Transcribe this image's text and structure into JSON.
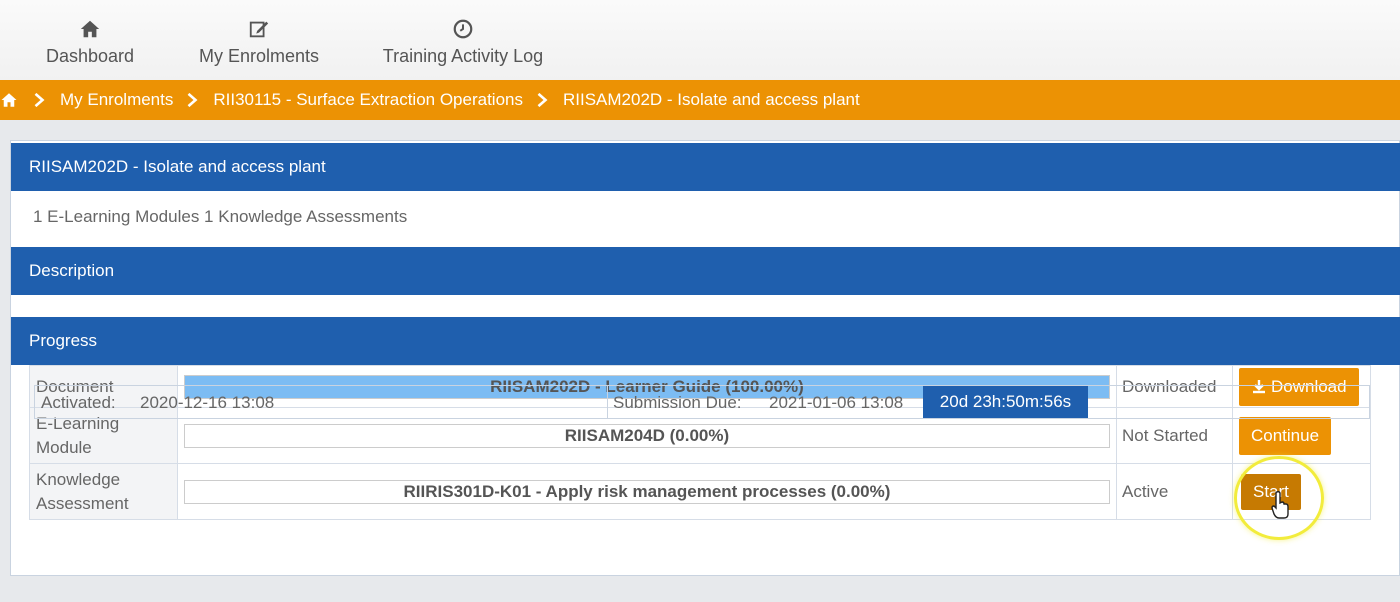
{
  "nav": {
    "items": [
      {
        "label": "Dashboard",
        "icon": "home-icon"
      },
      {
        "label": "My Enrolments",
        "icon": "edit-icon"
      },
      {
        "label": "Training Activity Log",
        "icon": "clock-icon"
      }
    ]
  },
  "breadcrumb": {
    "items": [
      "My Enrolments",
      "RII30115 - Surface Extraction Operations",
      "RIISAM202D - Isolate and access plant"
    ]
  },
  "unit": {
    "title": "RIISAM202D - Isolate and access plant",
    "summary": "1 E-Learning Modules 1 Knowledge Assessments"
  },
  "sections": {
    "description": "Description",
    "progress": "Progress"
  },
  "progress": {
    "rows": [
      {
        "type": "Document",
        "item": "RIISAM202D - Learner Guide (100.00%)",
        "percent": 100,
        "status": "Downloaded",
        "action": "Download"
      },
      {
        "type": "E-Learning Module",
        "item": "RIISAM204D (0.00%)",
        "percent": 0,
        "status": "Not Started",
        "action": "Continue"
      },
      {
        "type": "Knowledge Assessment",
        "item": "RIIRIS301D-K01 - Apply risk management processes (0.00%)",
        "percent": 0,
        "status": "Active",
        "action": "Start"
      }
    ]
  },
  "dates": {
    "activated_label": "Activated:",
    "activated_value": "2020-12-16 13:08",
    "due_label": "Submission Due:",
    "due_value": "2021-01-06 13:08",
    "countdown": "20d 23h:50m:56s"
  },
  "colors": {
    "accent_orange": "#ec9204",
    "header_blue": "#1f5fae",
    "progress_fill": "#7cbcf3"
  }
}
